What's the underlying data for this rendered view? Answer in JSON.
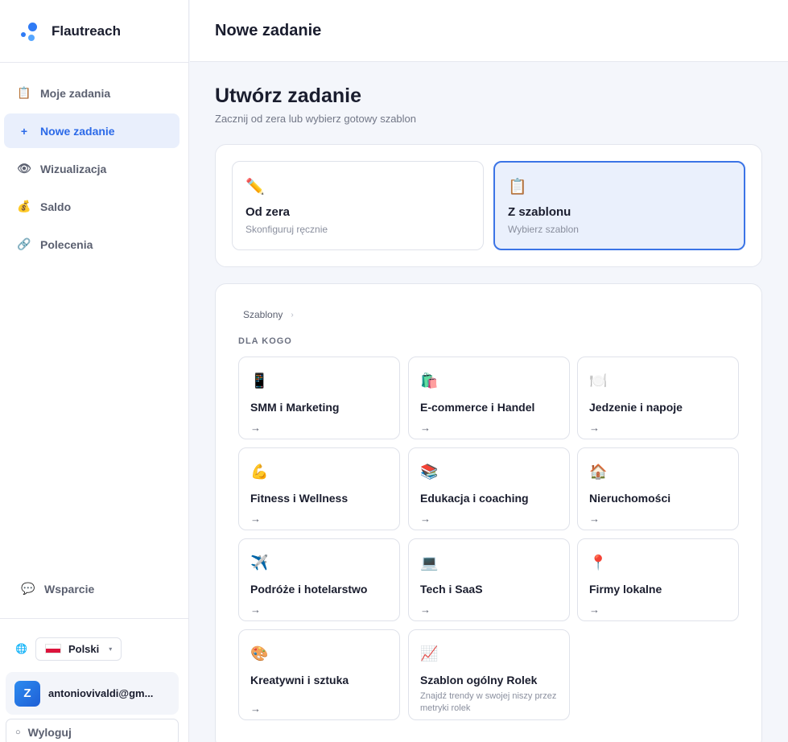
{
  "brand": {
    "name": "Flautreach",
    "accent": "#2c6ae8"
  },
  "sidebar": {
    "items": [
      {
        "label": "Moje zadania",
        "icon": "clipboard-icon",
        "glyph": "📋"
      },
      {
        "label": "Nowe zadanie",
        "icon": "plus-icon",
        "glyph": "+"
      },
      {
        "label": "Wizualizacja",
        "icon": "eye-icon",
        "glyph": "👁"
      },
      {
        "label": "Saldo",
        "icon": "money-bag-icon",
        "glyph": "💰"
      },
      {
        "label": "Polecenia",
        "icon": "link-icon",
        "glyph": "🔗"
      }
    ],
    "support": {
      "label": "Wsparcie",
      "icon": "speech-bubble-icon",
      "glyph": "💬"
    },
    "language": {
      "selected": "Polski",
      "globe_glyph": "🌐",
      "caret_glyph": "▾"
    },
    "user": {
      "initial": "Z",
      "email": "antoniovivaldi@gm..."
    },
    "logout": {
      "label": "Wyloguj",
      "glyph": "○"
    }
  },
  "header": {
    "title": "Nowe zadanie"
  },
  "main": {
    "title": "Utwórz zadanie",
    "subtitle": "Zacznij od zera lub wybierz gotowy szablon",
    "modes": [
      {
        "glyph": "✏️",
        "icon": "pencil-icon",
        "label": "Od zera",
        "desc": "Skonfiguruj ręcznie",
        "selected": false
      },
      {
        "glyph": "📋",
        "icon": "clipboard-icon",
        "label": "Z szablonu",
        "desc": "Wybierz szablon",
        "selected": true
      }
    ],
    "templates": {
      "breadcrumb": "Szablony",
      "breadcrumb_sep": "›",
      "section_label": "DLA KOGO",
      "arrow": "→",
      "tiles": [
        {
          "glyph": "📱",
          "icon": "phone-icon",
          "label": "SMM i Marketing"
        },
        {
          "glyph": "🛍️",
          "icon": "shopping-bags-icon",
          "label": "E-commerce i Handel"
        },
        {
          "glyph": "🍽️",
          "icon": "plate-icon",
          "label": "Jedzenie i napoje"
        },
        {
          "glyph": "💪",
          "icon": "biceps-icon",
          "label": "Fitness i Wellness"
        },
        {
          "glyph": "📚",
          "icon": "books-icon",
          "label": "Edukacja i coaching"
        },
        {
          "glyph": "🏠",
          "icon": "house-icon",
          "label": "Nieruchomości"
        },
        {
          "glyph": "✈️",
          "icon": "airplane-icon",
          "label": "Podróże i hotelarstwo"
        },
        {
          "glyph": "💻",
          "icon": "laptop-icon",
          "label": "Tech i SaaS"
        },
        {
          "glyph": "📍",
          "icon": "pin-icon",
          "label": "Firmy lokalne"
        },
        {
          "glyph": "🎨",
          "icon": "palette-icon",
          "label": "Kreatywni i sztuka"
        },
        {
          "glyph": "📈",
          "icon": "chart-icon",
          "label": "Szablon ogólny Rolek",
          "desc": "Znajdź trendy w swojej niszy przez metryki rolek"
        }
      ]
    }
  }
}
